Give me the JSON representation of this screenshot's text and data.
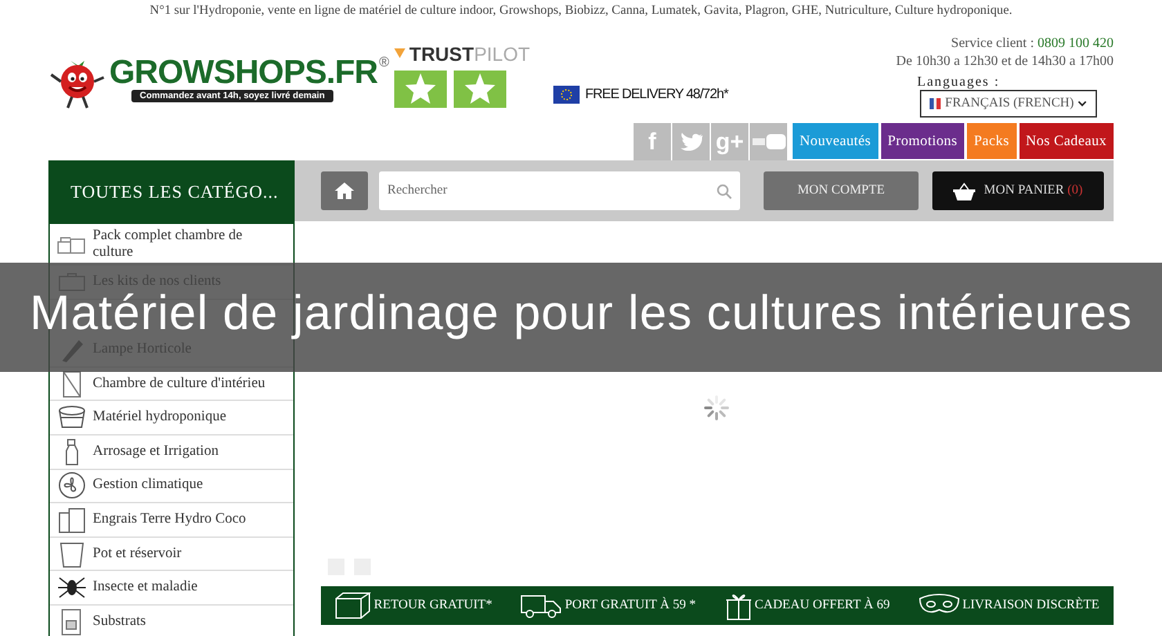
{
  "tagline": "N°1 sur l'Hydroponie, vente en ligne de matériel de culture indoor, Growshops, Biobizz, Canna, Lumatek, Gavita, Plagron, GHE, Nutriculture, Culture hydroponique.",
  "logo": {
    "name": "GROWSHOPS.FR",
    "mark": "®",
    "slogan": "Commandez avant 14h, soyez livré demain"
  },
  "trustpilot": {
    "label": "**TRUST**PILOT"
  },
  "delivery": {
    "label": "FREE DELIVERY 48/72h*"
  },
  "service": {
    "label": "Service client : ",
    "phone": "0809 100 420",
    "hours": "De 10h30 a 12h30 et de 14h30 a 17h00"
  },
  "languages": {
    "label": "Languages :",
    "value": "FRANÇAIS (FRENCH)"
  },
  "social": [
    {
      "kind": "facebook",
      "label": "f"
    },
    {
      "kind": "twitter"
    },
    {
      "kind": "googleplus",
      "label": "g+"
    },
    {
      "kind": "youtube"
    }
  ],
  "nav": [
    {
      "label": "Nouveautés",
      "color": "#1b9bd7"
    },
    {
      "label": "Promotions",
      "color": "#6b2d8c"
    },
    {
      "label": "Packs",
      "color": "#f47b20"
    },
    {
      "label": "Nos Cadeaux",
      "color": "#c1171b"
    }
  ],
  "sidebar": {
    "title": "TOUTES LES CATÉGO...",
    "items": [
      {
        "kind": "box",
        "label": "Pack complet chambre de culture"
      },
      {
        "kind": "kit",
        "label": "Les kits de nos clients"
      },
      {
        "kind": "hidden"
      },
      {
        "kind": "lamp",
        "label": "Lampe Horticole"
      },
      {
        "kind": "tent",
        "label": "Chambre de culture d'intérieu"
      },
      {
        "kind": "tub",
        "label": "Matériel hydroponique"
      },
      {
        "kind": "spray",
        "label": "Arrosage et Irrigation"
      },
      {
        "kind": "fan",
        "label": "Gestion climatique"
      },
      {
        "kind": "can",
        "label": "Engrais Terre Hydro Coco"
      },
      {
        "kind": "pot",
        "label": "Pot et réservoir"
      },
      {
        "kind": "bug",
        "label": "Insecte et maladie"
      },
      {
        "kind": "bag",
        "label": "Substrats"
      }
    ]
  },
  "search": {
    "placeholder": "Rechercher"
  },
  "account": {
    "label": "MON COMPTE"
  },
  "cart": {
    "label": "MON PANIER ",
    "count": "(0)"
  },
  "features": [
    {
      "kind": "box",
      "label": "RETOUR GRATUIT*"
    },
    {
      "kind": "truck",
      "label": "PORT GRATUIT À 59 *"
    },
    {
      "kind": "gift",
      "label": "CADEAU OFFERT À 69"
    },
    {
      "kind": "mask",
      "label": "LIVRAISON DISCRÈTE"
    }
  ],
  "caption": "Matériel de jardinage pour les cultures intérieures"
}
